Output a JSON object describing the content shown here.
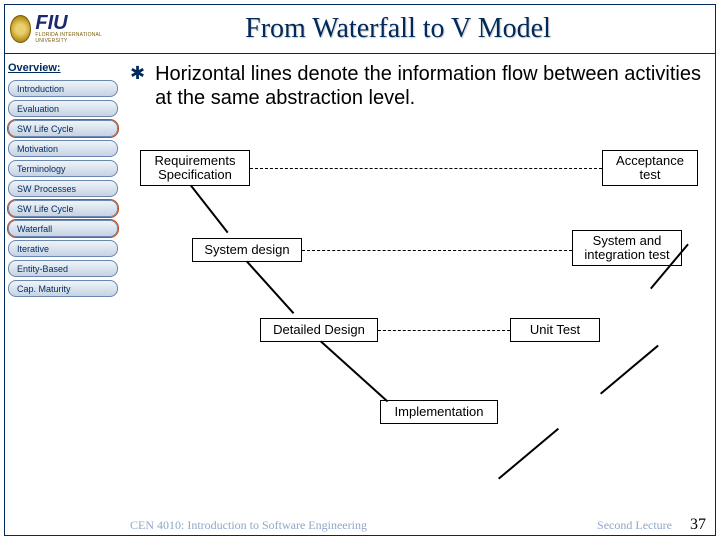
{
  "header": {
    "logo_main": "FIU",
    "logo_sub": "FLORIDA INTERNATIONAL UNIVERSITY",
    "title": "From Waterfall to V Model"
  },
  "sidebar": {
    "section_label": "Overview:",
    "items": [
      {
        "label": "Introduction",
        "highlight": false
      },
      {
        "label": "Evaluation",
        "highlight": false
      },
      {
        "label": "SW Life Cycle",
        "highlight": true
      },
      {
        "label": "Motivation",
        "highlight": false
      },
      {
        "label": "Terminology",
        "highlight": false
      },
      {
        "label": "SW Processes",
        "highlight": false
      },
      {
        "label": "SW Life Cycle",
        "highlight": true
      },
      {
        "label": "Waterfall",
        "highlight": true
      },
      {
        "label": "Iterative",
        "highlight": false
      },
      {
        "label": "Entity-Based",
        "highlight": false
      },
      {
        "label": "Cap. Maturity",
        "highlight": false
      }
    ]
  },
  "bullet": {
    "text": "Horizontal lines denote the information flow between activities at the same abstraction level."
  },
  "diagram": {
    "boxes": {
      "req": "Requirements\nSpecification",
      "acc": "Acceptance\ntest",
      "sys": "System design",
      "sit": "System and\nintegration test",
      "det": "Detailed Design",
      "unit": "Unit Test",
      "impl": "Implementation"
    }
  },
  "footer": {
    "course": "CEN 4010: Introduction to Software Engineering",
    "lecture": "Second Lecture",
    "page": "37"
  }
}
